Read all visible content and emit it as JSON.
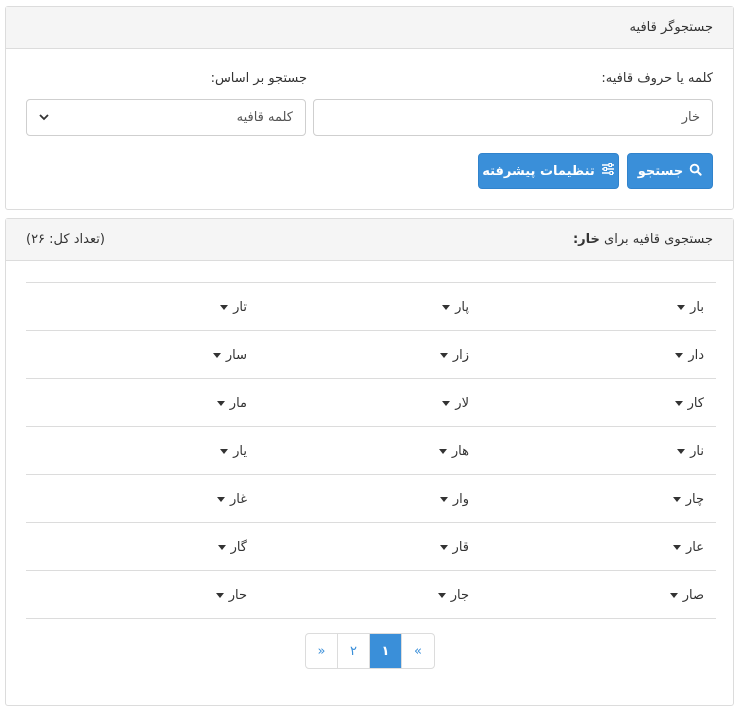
{
  "search_panel": {
    "title": "جستجوگر قافیه",
    "word_label": "کلمه یا حروف قافیه:",
    "word_value": "خار",
    "basis_label": "جستجو بر اساس:",
    "basis_selected": "کلمه قافیه",
    "search_button": "جستجو",
    "advanced_button": "تنظیمات پیشرفته"
  },
  "results_panel": {
    "title_prefix": "جستجوی قافیه برای",
    "query": "خار:",
    "total": "(تعداد کل: ۲۶)",
    "rows": [
      [
        "بار",
        "پار",
        "تار"
      ],
      [
        "دار",
        "زار",
        "سار"
      ],
      [
        "کار",
        "لار",
        "مار"
      ],
      [
        "نار",
        "هار",
        "یار"
      ],
      [
        "چار",
        "وار",
        "غار"
      ],
      [
        "عار",
        "قار",
        "گار"
      ],
      [
        "صار",
        "جار",
        "حار"
      ]
    ]
  },
  "pagination": {
    "prev": "«",
    "pages": [
      "۱",
      "۲"
    ],
    "next": "»"
  },
  "colors": {
    "accent": "#3a8fd9",
    "heading_bg": "#f5f5f5",
    "border": "#dcdcdc"
  }
}
